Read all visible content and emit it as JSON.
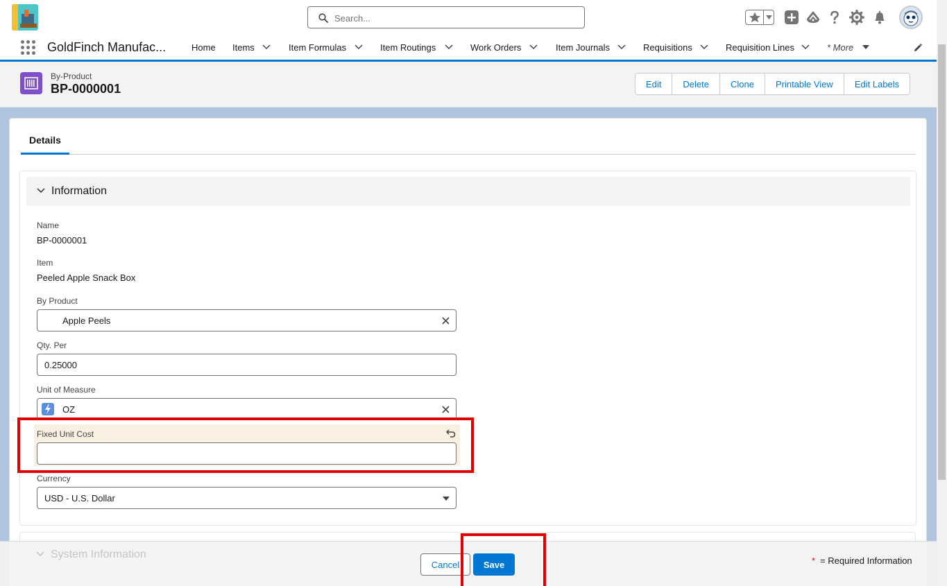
{
  "header": {
    "search_placeholder": "Search..."
  },
  "app": {
    "name": "GoldFinch Manufac..."
  },
  "nav": {
    "items": [
      {
        "label": "Home",
        "has_menu": false
      },
      {
        "label": "Items",
        "has_menu": true
      },
      {
        "label": "Item Formulas",
        "has_menu": true
      },
      {
        "label": "Item Routings",
        "has_menu": true
      },
      {
        "label": "Work Orders",
        "has_menu": true
      },
      {
        "label": "Item Journals",
        "has_menu": true
      },
      {
        "label": "Requisitions",
        "has_menu": true
      },
      {
        "label": "Requisition Lines",
        "has_menu": true
      }
    ],
    "more_label": "* More"
  },
  "record": {
    "object_type": "By-Product",
    "title": "BP-0000001",
    "actions": [
      "Edit",
      "Delete",
      "Clone",
      "Printable View",
      "Edit Labels"
    ]
  },
  "tabs": {
    "active": "Details"
  },
  "section": {
    "title": "Information",
    "second_title": "System Information"
  },
  "fields": {
    "name": {
      "label": "Name",
      "value": "BP-0000001"
    },
    "item": {
      "label": "Item",
      "value": "Peeled Apple Snack Box"
    },
    "by_product": {
      "label": "By Product",
      "value": "Apple Peels"
    },
    "qty_per": {
      "label": "Qty. Per",
      "value": "0.25000"
    },
    "uom": {
      "label": "Unit of Measure",
      "value": "OZ"
    },
    "fixed_unit_cost": {
      "label": "Fixed Unit Cost",
      "value": ""
    },
    "currency": {
      "label": "Currency",
      "value": "USD - U.S. Dollar"
    }
  },
  "footer": {
    "cancel_label": "Cancel",
    "save_label": "Save",
    "required_asterisk": "*",
    "required_text": "= Required Information"
  },
  "colors": {
    "brand": "#0176d3",
    "annotation": "#e00000",
    "changed_field": "#faf0e1",
    "object_icon": "#7f4fc9"
  }
}
